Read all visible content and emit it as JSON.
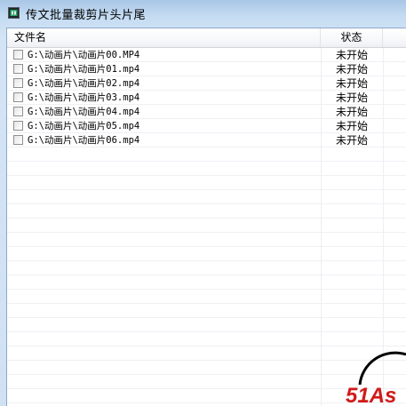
{
  "window": {
    "title": "传文批量裁剪片头片尾",
    "icon": "app-logo-icon"
  },
  "table": {
    "columns": [
      "文件名",
      "状态",
      ""
    ],
    "rows": [
      {
        "file": "G:\\动画片\\动画片00.MP4",
        "status": "未开始",
        "checked": false
      },
      {
        "file": "G:\\动画片\\动画片01.mp4",
        "status": "未开始",
        "checked": false
      },
      {
        "file": "G:\\动画片\\动画片02.mp4",
        "status": "未开始",
        "checked": false
      },
      {
        "file": "G:\\动画片\\动画片03.mp4",
        "status": "未开始",
        "checked": false
      },
      {
        "file": "G:\\动画片\\动画片04.mp4",
        "status": "未开始",
        "checked": false
      },
      {
        "file": "G:\\动画片\\动画片05.mp4",
        "status": "未开始",
        "checked": false
      },
      {
        "file": "G:\\动画片\\动画片06.mp4",
        "status": "未开始",
        "checked": false
      }
    ]
  },
  "watermark": {
    "text": "51As",
    "color": "#d11a1a"
  }
}
